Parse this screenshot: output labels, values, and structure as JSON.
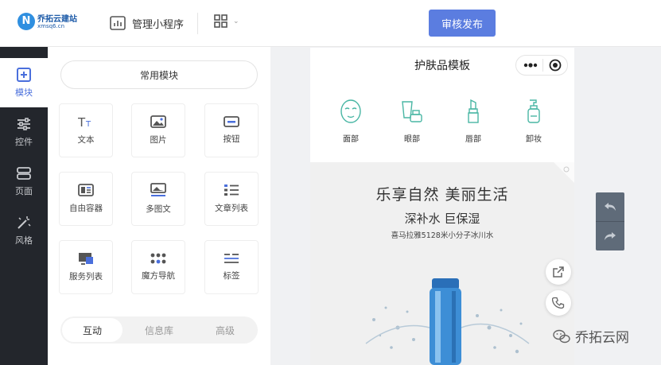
{
  "brand": {
    "name": "乔拓云建站",
    "url": "xmsq6.cn",
    "badge": "N"
  },
  "header": {
    "miniprogram_label": "管理小程序",
    "publish_label": "审核发布"
  },
  "leftnav": {
    "items": [
      {
        "label": "模块",
        "icon": "plus-square-icon",
        "active": true
      },
      {
        "label": "控件",
        "icon": "sliders-icon",
        "active": false
      },
      {
        "label": "页面",
        "icon": "pages-icon",
        "active": false
      },
      {
        "label": "风格",
        "icon": "magic-wand-icon",
        "active": false
      }
    ]
  },
  "panel": {
    "section_title": "常用模块",
    "tiles": [
      {
        "label": "文本",
        "icon": "text-icon"
      },
      {
        "label": "图片",
        "icon": "image-icon"
      },
      {
        "label": "按钮",
        "icon": "button-icon"
      },
      {
        "label": "自由容器",
        "icon": "container-icon"
      },
      {
        "label": "多图文",
        "icon": "multi-image-text-icon"
      },
      {
        "label": "文章列表",
        "icon": "article-list-icon"
      },
      {
        "label": "服务列表",
        "icon": "service-list-icon"
      },
      {
        "label": "魔方导航",
        "icon": "grid-nav-icon"
      },
      {
        "label": "标签",
        "icon": "tag-icon"
      }
    ],
    "tabs": [
      {
        "label": "互动",
        "active": true
      },
      {
        "label": "信息库",
        "active": false
      },
      {
        "label": "高级",
        "active": false
      }
    ]
  },
  "phone": {
    "title": "护肤品模板",
    "categories": [
      {
        "label": "面部",
        "icon": "face-mask-icon"
      },
      {
        "label": "眼部",
        "icon": "eye-care-icon"
      },
      {
        "label": "唇部",
        "icon": "lipstick-icon"
      },
      {
        "label": "卸妆",
        "icon": "pump-bottle-icon"
      }
    ],
    "banner": {
      "headline": "乐享自然  美丽生活",
      "subheadline": "深补水  巨保湿",
      "caption": "喜马拉雅5128米小分子冰川水"
    }
  },
  "watermark": {
    "text": "乔拓云网"
  },
  "colors": {
    "accent": "#5b7de0",
    "nav_bg": "#23262c",
    "teal": "#49b6a4",
    "undo_bg": "#5f6b79"
  }
}
